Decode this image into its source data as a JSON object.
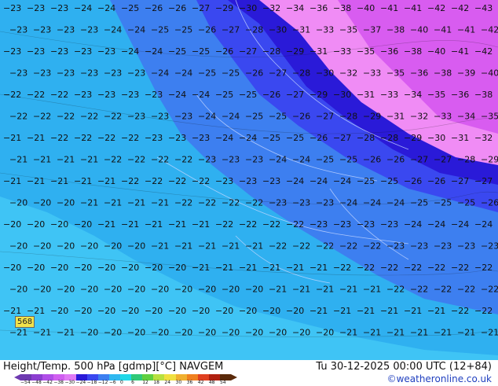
{
  "map": {
    "tokens": [
      [
        "−23",
        "−23",
        "−23",
        "−24",
        "−24",
        "−25",
        "−26",
        "−26",
        "−27",
        "−29",
        "−30",
        "−32",
        "−34",
        "−36",
        "−38",
        "−40",
        "−41",
        "−41",
        "−42",
        "−42",
        "−43"
      ],
      [
        "−23",
        "−23",
        "−23",
        "−23",
        "−24",
        "−24",
        "−25",
        "−25",
        "−26",
        "−27",
        "−28",
        "−30",
        "−31",
        "−33",
        "−35",
        "−37",
        "−38",
        "−40",
        "−41",
        "−41",
        "−42"
      ],
      [
        "−23",
        "−23",
        "−23",
        "−23",
        "−23",
        "−24",
        "−24",
        "−25",
        "−25",
        "−26",
        "−27",
        "−28",
        "−29",
        "−31",
        "−33",
        "−35",
        "−36",
        "−38",
        "−40",
        "−41",
        "−42"
      ],
      [
        "−23",
        "−23",
        "−23",
        "−23",
        "−23",
        "−23",
        "−24",
        "−24",
        "−25",
        "−25",
        "−26",
        "−27",
        "−28",
        "−30",
        "−32",
        "−33",
        "−35",
        "−36",
        "−38",
        "−39",
        "−40"
      ],
      [
        "−22",
        "−22",
        "−22",
        "−23",
        "−23",
        "−23",
        "−23",
        "−24",
        "−24",
        "−25",
        "−25",
        "−26",
        "−27",
        "−29",
        "−30",
        "−31",
        "−33",
        "−34",
        "−35",
        "−36",
        "−38"
      ],
      [
        "−22",
        "−22",
        "−22",
        "−22",
        "−22",
        "−23",
        "−23",
        "−23",
        "−24",
        "−24",
        "−25",
        "−25",
        "−26",
        "−27",
        "−28",
        "−29",
        "−31",
        "−32",
        "−33",
        "−34",
        "−35"
      ],
      [
        "−21",
        "−21",
        "−22",
        "−22",
        "−22",
        "−22",
        "−23",
        "−23",
        "−23",
        "−24",
        "−24",
        "−25",
        "−25",
        "−26",
        "−27",
        "−28",
        "−28",
        "−29",
        "−30",
        "−31",
        "−32"
      ],
      [
        "−21",
        "−21",
        "−21",
        "−21",
        "−22",
        "−22",
        "−22",
        "−22",
        "−23",
        "−23",
        "−23",
        "−24",
        "−24",
        "−25",
        "−25",
        "−26",
        "−26",
        "−27",
        "−27",
        "−28",
        "−29"
      ],
      [
        "−21",
        "−21",
        "−21",
        "−21",
        "−21",
        "−22",
        "−22",
        "−22",
        "−22",
        "−23",
        "−23",
        "−23",
        "−24",
        "−24",
        "−24",
        "−25",
        "−25",
        "−26",
        "−26",
        "−27",
        "−27"
      ],
      [
        "−20",
        "−20",
        "−20",
        "−21",
        "−21",
        "−21",
        "−21",
        "−22",
        "−22",
        "−22",
        "−22",
        "−23",
        "−23",
        "−23",
        "−24",
        "−24",
        "−24",
        "−25",
        "−25",
        "−25",
        "−26"
      ],
      [
        "−20",
        "−20",
        "−20",
        "−20",
        "−21",
        "−21",
        "−21",
        "−21",
        "−21",
        "−22",
        "−22",
        "−22",
        "−22",
        "−23",
        "−23",
        "−23",
        "−23",
        "−24",
        "−24",
        "−24",
        "−24"
      ],
      [
        "−20",
        "−20",
        "−20",
        "−20",
        "−20",
        "−20",
        "−21",
        "−21",
        "−21",
        "−21",
        "−21",
        "−22",
        "−22",
        "−22",
        "−22",
        "−22",
        "−23",
        "−23",
        "−23",
        "−23",
        "−23"
      ],
      [
        "−20",
        "−20",
        "−20",
        "−20",
        "−20",
        "−20",
        "−20",
        "−20",
        "−21",
        "−21",
        "−21",
        "−21",
        "−21",
        "−21",
        "−22",
        "−22",
        "−22",
        "−22",
        "−22",
        "−22",
        "−22"
      ],
      [
        "−20",
        "−20",
        "−20",
        "−20",
        "−20",
        "−20",
        "−20",
        "−20",
        "−20",
        "−20",
        "−20",
        "−21",
        "−21",
        "−21",
        "−21",
        "−21",
        "−22",
        "−22",
        "−22",
        "−22",
        "−22"
      ],
      [
        "−21",
        "−21",
        "−20",
        "−20",
        "−20",
        "−20",
        "−20",
        "−20",
        "−20",
        "−20",
        "−20",
        "−20",
        "−20",
        "−21",
        "−21",
        "−21",
        "−21",
        "−21",
        "−21",
        "−22",
        "−22"
      ],
      [
        "−21",
        "−21",
        "−21",
        "−20",
        "−20",
        "−20",
        "−20",
        "−20",
        "−20",
        "−20",
        "−20",
        "−20",
        "−20",
        "−20",
        "−21",
        "−21",
        "−21",
        "−21",
        "−21",
        "−21",
        "−21"
      ]
    ],
    "station_value": "568"
  },
  "footer": {
    "title": "Height/Temp. 500 hPa [gdmp][°C] NAVGEM",
    "valid_time": "Tu 30-12-2025 00:00 UTC (12+84)",
    "credit": "©weatheronline.co.uk"
  },
  "colorbar": {
    "ticks": [
      "−54",
      "−48",
      "−42",
      "−38",
      "−30",
      "−24",
      "−18",
      "−12",
      "−6",
      "0",
      "6",
      "12",
      "18",
      "24",
      "30",
      "36",
      "42",
      "48",
      "54"
    ],
    "colors": [
      "#6e3ab0",
      "#8c3fd0",
      "#b04fe8",
      "#d060f0",
      "#e07bf5",
      "#2a1ad8",
      "#3a48f0",
      "#3d7ff0",
      "#30b8f0",
      "#20d8e8",
      "#30c878",
      "#60d040",
      "#b8e040",
      "#f0e040",
      "#f0b030",
      "#f08020",
      "#e04020",
      "#b02010",
      "#5a2a0a"
    ]
  }
}
